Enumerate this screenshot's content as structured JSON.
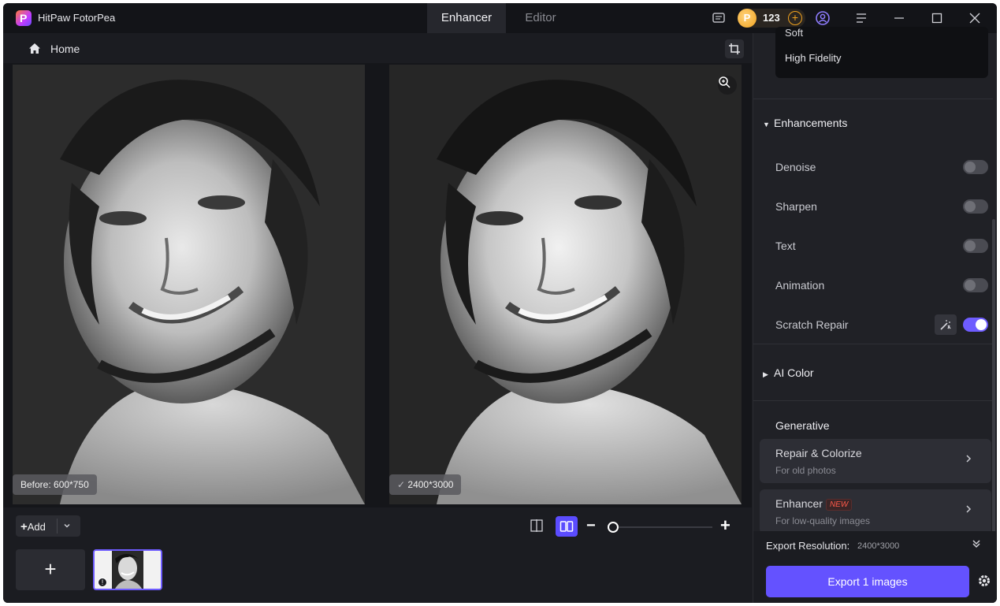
{
  "app": {
    "title": "HitPaw FotorPea",
    "logo_letter": "P"
  },
  "tabs": [
    {
      "label": "Enhancer",
      "active": true
    },
    {
      "label": "Editor",
      "active": false
    }
  ],
  "titlebar": {
    "credits": "123",
    "coin_letter": "P",
    "credits_plus": "+",
    "icons": [
      "feedback-icon",
      "account-icon",
      "menu-icon",
      "minimize-icon",
      "maximize-icon",
      "close-icon"
    ]
  },
  "breadcrumb": {
    "home_label": "Home"
  },
  "canvas": {
    "before_label": "Before: 600*750",
    "after_label": "2400*3000"
  },
  "bottombar": {
    "add_label": "Add",
    "add_plus": "+",
    "add_thumb_plus": "+",
    "zoom_minus": "−",
    "zoom_plus": "+",
    "zoom_level": 0.05
  },
  "panel": {
    "mode_options": [
      "Soft",
      "High Fidelity"
    ],
    "enhancements": {
      "title": "Enhancements",
      "options": [
        {
          "label": "Denoise",
          "on": false
        },
        {
          "label": "Sharpen",
          "on": false
        },
        {
          "label": "Text",
          "on": false
        },
        {
          "label": "Animation",
          "on": false
        },
        {
          "label": "Scratch Repair",
          "on": true
        }
      ]
    },
    "ai_color": {
      "title": "AI Color"
    },
    "generative": {
      "title": "Generative",
      "cards": [
        {
          "title": "Repair & Colorize",
          "subtitle": "For old photos",
          "badge": ""
        },
        {
          "title": "Enhancer",
          "subtitle": "For low-quality images",
          "badge": "NEW"
        }
      ]
    },
    "export": {
      "resolution_label": "Export Resolution:",
      "resolution_value": "2400*3000",
      "button_label": "Export 1 images"
    }
  },
  "colors": {
    "accent": "#6452ff",
    "badge_new": "#ff5a4a",
    "coin": "#f0a21e"
  }
}
